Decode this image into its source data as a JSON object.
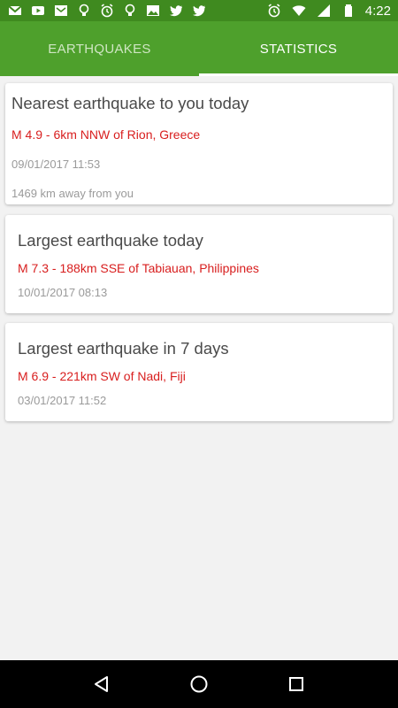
{
  "status_bar": {
    "time": "4:22",
    "left_icons": [
      "gmail-icon",
      "youtube-icon",
      "mail-icon",
      "bulb-icon",
      "alarm-icon",
      "bulb-icon",
      "image-icon",
      "twitter-icon",
      "twitter-icon"
    ],
    "right_icons": [
      "alarm-icon",
      "wifi-icon",
      "signal-icon",
      "battery-icon"
    ],
    "color": "#3f8a1f"
  },
  "tabs": {
    "items": [
      {
        "label": "EARTHQUAKES",
        "active": false
      },
      {
        "label": "STATISTICS",
        "active": true
      }
    ],
    "color": "#4ea02c"
  },
  "cards": [
    {
      "title": "Nearest earthquake to you today",
      "quake": "M 4.9 - 6km NNW of Rion, Greece",
      "time": "09/01/2017 11:53",
      "distance": "1469 km away from you"
    },
    {
      "title": "Largest earthquake today",
      "quake": "M 7.3 - 188km SSE of Tabiauan, Philippines",
      "time": "10/01/2017 08:13"
    },
    {
      "title": "Largest earthquake in 7 days",
      "quake": "M 6.9 - 221km SW of Nadi, Fiji",
      "time": "03/01/2017 11:52"
    }
  ],
  "nav": {
    "icons": [
      "back-icon",
      "home-icon",
      "recents-icon"
    ]
  },
  "colors": {
    "quake_red": "#d81e1e"
  }
}
